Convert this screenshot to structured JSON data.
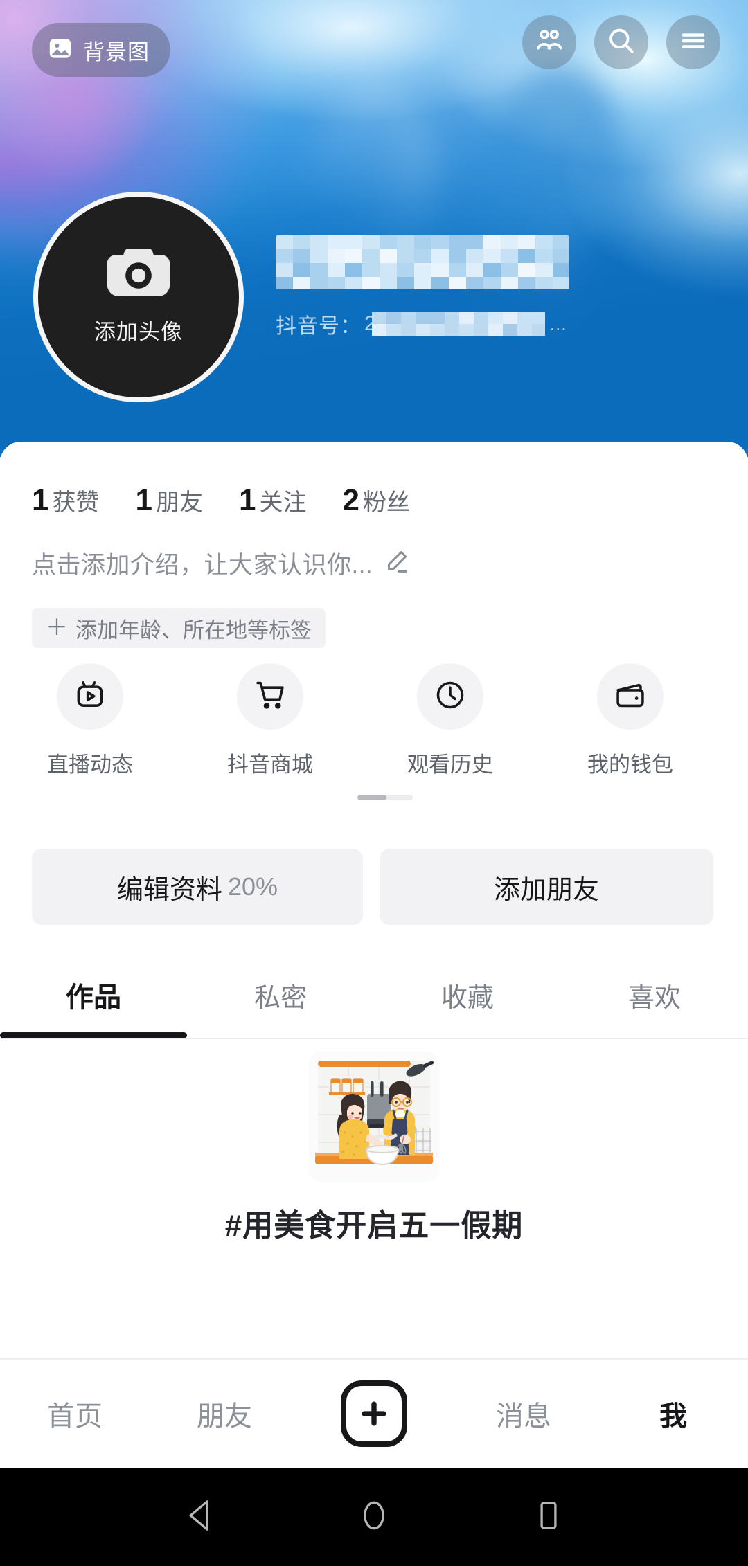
{
  "cover": {
    "background_button": {
      "label": "背景图",
      "icon": "image-icon"
    },
    "actions": [
      {
        "name": "friends",
        "icon": "people-icon"
      },
      {
        "name": "search",
        "icon": "search-icon"
      },
      {
        "name": "menu",
        "icon": "hamburger-icon"
      }
    ],
    "colors": {
      "blue": "#0c6cbc",
      "light_blue": "#8cc6f2",
      "purple": "#925cd6",
      "pale_cyan": "#e8f8ff"
    }
  },
  "profile": {
    "avatar": {
      "label": "添加头像",
      "icon": "camera-icon"
    },
    "nickname": "",
    "nickname_masked": true,
    "douyin_id_label": "抖音号：",
    "douyin_id_value": "2",
    "douyin_id_masked": true,
    "douyin_id_ellipsis": "…"
  },
  "stats": [
    {
      "num": "1",
      "label": "获赞"
    },
    {
      "num": "1",
      "label": "朋友"
    },
    {
      "num": "1",
      "label": "关注"
    },
    {
      "num": "2",
      "label": "粉丝"
    }
  ],
  "bio": {
    "placeholder": "点击添加介绍，让大家认识你...",
    "edit_icon": "pencil-icon",
    "tag_button": {
      "plus": "＋",
      "label": "添加年龄、所在地等标签"
    }
  },
  "quick_actions": [
    {
      "label": "直播动态",
      "icon": "tv-play-icon"
    },
    {
      "label": "抖音商城",
      "icon": "cart-icon"
    },
    {
      "label": "观看历史",
      "icon": "clock-icon"
    },
    {
      "label": "我的钱包",
      "icon": "wallet-icon"
    }
  ],
  "buttons": {
    "edit_profile": "编辑资料",
    "edit_profile_percent": "20%",
    "add_friend": "添加朋友"
  },
  "tabs": [
    {
      "label": "作品",
      "active": true
    },
    {
      "label": "私密",
      "active": false
    },
    {
      "label": "收藏",
      "active": false
    },
    {
      "label": "喜欢",
      "active": false
    }
  ],
  "empty_state": {
    "caption": "#用美食开启五一假期",
    "illustration": "cooking-couple-illustration"
  },
  "bottom_nav": [
    {
      "label": "首页",
      "active": false
    },
    {
      "label": "朋友",
      "active": false
    },
    {
      "label": "",
      "icon": "plus-icon",
      "active": false
    },
    {
      "label": "消息",
      "active": false
    },
    {
      "label": "我",
      "active": true
    }
  ],
  "system_bar": [
    {
      "name": "back",
      "icon": "triangle-back-icon"
    },
    {
      "name": "home",
      "icon": "circle-home-icon"
    },
    {
      "name": "recents",
      "icon": "square-recents-icon"
    }
  ]
}
